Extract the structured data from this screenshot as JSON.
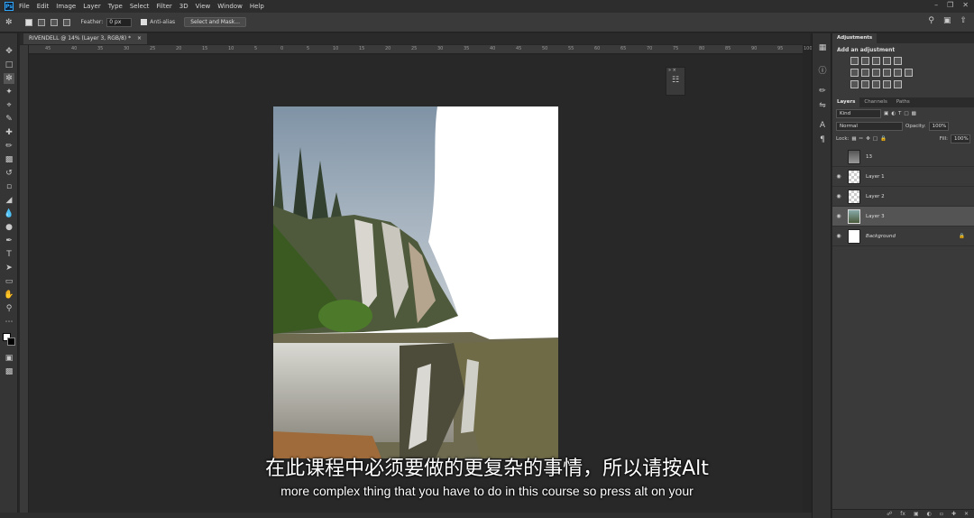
{
  "app": {
    "logo": "Ps"
  },
  "menu": [
    "File",
    "Edit",
    "Image",
    "Layer",
    "Type",
    "Select",
    "Filter",
    "3D",
    "View",
    "Window",
    "Help"
  ],
  "options": {
    "feather_label": "Feather:",
    "feather_value": "0 px",
    "antialias_label": "Anti-alias",
    "mask_button": "Select and Mask..."
  },
  "document": {
    "tab_title": "RIVENDELL @ 14% (Layer 3, RGB/8) *",
    "close_glyph": "×"
  },
  "ruler_ticks": [
    "45",
    "40",
    "35",
    "30",
    "25",
    "20",
    "15",
    "10",
    "5",
    "0",
    "5",
    "10",
    "15",
    "20",
    "25",
    "30",
    "35",
    "40",
    "45",
    "50",
    "55",
    "60",
    "65",
    "70",
    "75",
    "80",
    "85",
    "90",
    "95",
    "100"
  ],
  "panels": {
    "adjustments_tab": "Adjustments",
    "add_adjustment": "Add an adjustment",
    "layer_tabs": [
      "Layers",
      "Channels",
      "Paths"
    ],
    "filter_kind": "Kind",
    "blend_mode": "Normal",
    "opacity_label": "Opacity:",
    "opacity_value": "100%",
    "lock_label": "Lock:",
    "fill_label": "Fill:",
    "fill_value": "100%"
  },
  "layers": [
    {
      "name": "13",
      "visible": false
    },
    {
      "name": "Layer 1",
      "visible": true
    },
    {
      "name": "Layer 2",
      "visible": true
    },
    {
      "name": "Layer 3",
      "visible": true,
      "selected": true
    },
    {
      "name": "Background",
      "visible": true,
      "locked": true
    }
  ],
  "subtitles": {
    "chinese": "在此课程中必须要做的更复杂的事情，所以请按Alt",
    "english": "more complex thing that you have to do in this course so press alt on your"
  }
}
